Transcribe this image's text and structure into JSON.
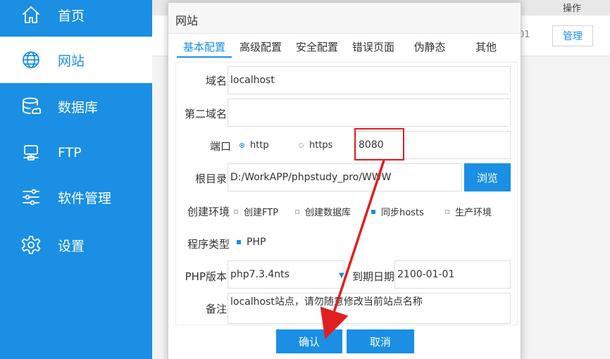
{
  "sidebar": {
    "items": [
      {
        "label": "首页",
        "icon": "home-icon"
      },
      {
        "label": "网站",
        "icon": "globe-icon",
        "active": true
      },
      {
        "label": "数据库",
        "icon": "database-icon"
      },
      {
        "label": "FTP",
        "icon": "ftp-server-icon"
      },
      {
        "label": "软件管理",
        "icon": "sliders-icon"
      },
      {
        "label": "设置",
        "icon": "gear-icon"
      }
    ]
  },
  "background_page": {
    "operations_header": "操作",
    "row_fragment": "01",
    "manage_button": "管理"
  },
  "dialog": {
    "title": "网站",
    "tabs": [
      "基本配置",
      "高级配置",
      "安全配置",
      "错误页面",
      "伪静态",
      "其他"
    ],
    "active_tab": "基本配置",
    "form": {
      "domain_label": "域名",
      "domain_value": "localhost",
      "second_domain_label": "第二域名",
      "second_domain_value": "",
      "port_label": "端口",
      "protocol_http": "http",
      "protocol_https": "https",
      "protocol_selected": "http",
      "port_value": "8080",
      "root_label": "根目录",
      "root_value": "D:/WorkAPP/phpstudy_pro/WWW",
      "browse_button": "浏览",
      "env_label": "创建环境",
      "env_options": [
        {
          "label": "创建FTP",
          "checked": false
        },
        {
          "label": "创建数据库",
          "checked": false
        },
        {
          "label": "同步hosts",
          "checked": true
        },
        {
          "label": "生产环境",
          "checked": false
        }
      ],
      "program_label": "程序类型",
      "program_option": "PHP",
      "program_checked": true,
      "php_version_label": "PHP版本",
      "php_version_value": "php7.3.4nts",
      "expiry_label": "到期日期",
      "expiry_value": "2100-01-01",
      "note_label": "备注",
      "note_value": "localhost站点，请勿随意修改当前站点名称"
    },
    "confirm_button": "确认",
    "cancel_button": "取消"
  },
  "colors": {
    "accent": "#1a8fe3",
    "annotation": "#e02020"
  }
}
